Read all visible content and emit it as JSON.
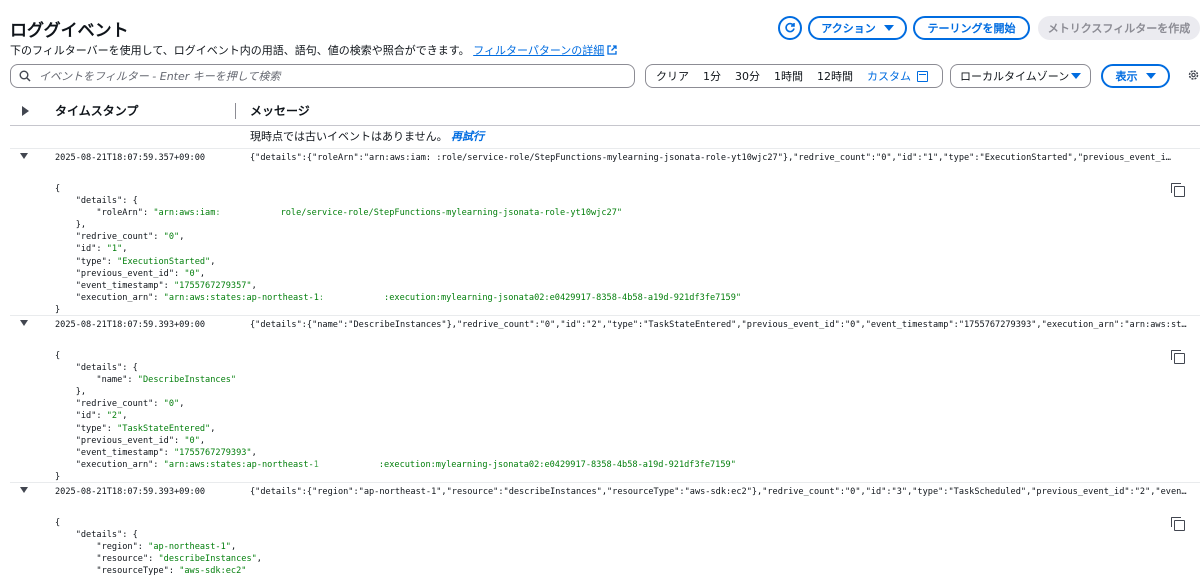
{
  "header": {
    "title": "ロググイベント",
    "description": "下のフィルターバーを使用して、ログイベント内の用語、語句、値の検索や照合ができます。",
    "filter_pattern_link": "フィルターパターンの詳細",
    "actions_label": "アクション",
    "tailing_label": "テーリングを開始",
    "metric_filter_label": "メトリクスフィルターを作成"
  },
  "filter": {
    "search_placeholder": "イベントをフィルター - Enter キーを押して検索",
    "ranges": [
      "クリア",
      "1分",
      "30分",
      "1時間",
      "12時間"
    ],
    "custom_label": "カスタム",
    "timezone_label": "ローカルタイムゾーン",
    "show_label": "表示"
  },
  "table": {
    "col_timestamp": "タイムスタンプ",
    "col_message": "メッセージ",
    "no_events_text": "現時点では古いイベントはありません。",
    "retry_link": "再試行"
  },
  "icons": {
    "search": "search-icon",
    "refresh": "refresh-icon",
    "external_link": "external-link-icon",
    "calendar": "calendar-icon",
    "settings": "gear-icon",
    "copy": "copy-icon"
  },
  "colors": {
    "accent": "#006ce0",
    "json_string": "#037f0c",
    "disabled_bg": "#ebebf0"
  },
  "events": [
    {
      "timestamp": "2025-08-21T18:07:59.357+09:00",
      "message": "{\"details\":{\"roleArn\":\"arn:aws:iam:                 :role/service-role/StepFunctions-mylearning-jsonata-role-yt10wjc27\"},\"redrive_count\":\"0\",\"id\":\"1\",\"type\":\"ExecutionStarted\",\"previous_event_i…",
      "json": {
        "roleArn_prefix": "\"arn:aws:iam:",
        "roleArn_suffix": "role/service-role/StepFunctions-mylearning-jsonata-role-yt10wjc27\"",
        "redrive_count": "\"0\"",
        "id": "\"1\"",
        "type": "\"ExecutionStarted\"",
        "previous_event_id": "\"0\"",
        "event_timestamp": "\"1755767279357\"",
        "execution_arn_prefix": "\"arn:aws:states:ap-northeast-1:",
        "execution_arn_suffix": ":execution:mylearning-jsonata02:e0429917-8358-4b58-a19d-921df3fe7159\""
      }
    },
    {
      "timestamp": "2025-08-21T18:07:59.393+09:00",
      "message": "{\"details\":{\"name\":\"DescribeInstances\"},\"redrive_count\":\"0\",\"id\":\"2\",\"type\":\"TaskStateEntered\",\"previous_event_id\":\"0\",\"event_timestamp\":\"1755767279393\",\"execution_arn\":\"arn:aws:states:ap-n…",
      "json": {
        "name": "\"DescribeInstances\"",
        "redrive_count": "\"0\"",
        "id": "\"2\"",
        "type": "\"TaskStateEntered\"",
        "previous_event_id": "\"0\"",
        "event_timestamp": "\"1755767279393\"",
        "execution_arn_prefix": "\"arn:aws:states:ap-northeast-1",
        "execution_arn_suffix": ":execution:mylearning-jsonata02:e0429917-8358-4b58-a19d-921df3fe7159\""
      }
    },
    {
      "timestamp": "2025-08-21T18:07:59.393+09:00",
      "message": "{\"details\":{\"region\":\"ap-northeast-1\",\"resource\":\"describeInstances\",\"resourceType\":\"aws-sdk:ec2\"},\"redrive_count\":\"0\",\"id\":\"3\",\"type\":\"TaskScheduled\",\"previous_event_id\":\"2\",\"event_timesta…",
      "json": {
        "region": "\"ap-northeast-1\"",
        "resource": "\"describeInstances\"",
        "resourceType": "\"aws-sdk:ec2\""
      }
    }
  ]
}
